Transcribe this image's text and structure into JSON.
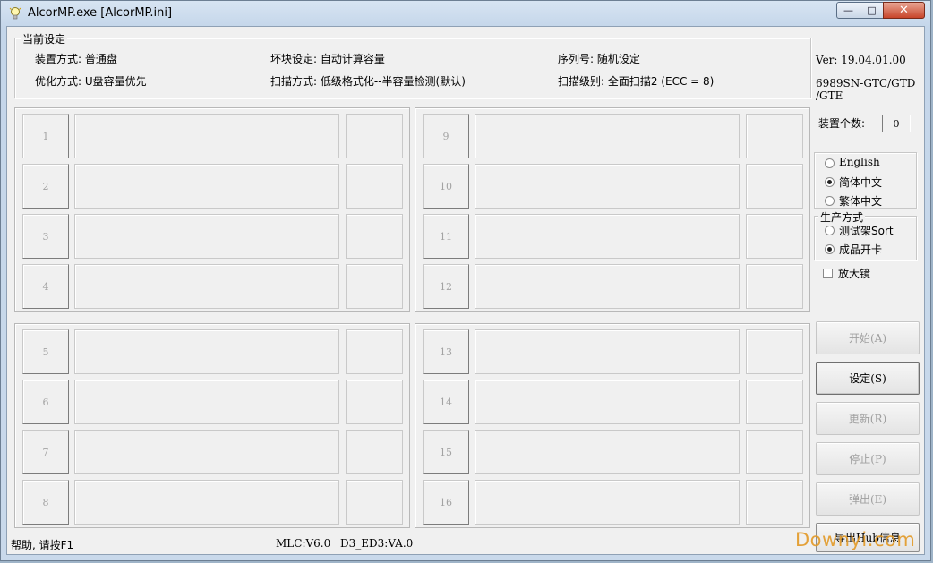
{
  "window": {
    "title": "AlcorMP.exe [AlcorMP.ini]",
    "buttons": {
      "minimize": "—",
      "maximize": "□",
      "close": "✕"
    }
  },
  "current_settings": {
    "legend": "当前设定",
    "device_mode": "装置方式: 普通盘",
    "bad_block": "坏块设定: 自动计算容量",
    "serial": "序列号: 随机设定",
    "optimize": "优化方式: U盘容量优先",
    "scan_mode": "扫描方式: 低级格式化--半容量检测(默认)",
    "scan_level": "扫描级别: 全面扫描2 (ECC = 8)"
  },
  "info": {
    "version": "Ver: 19.04.01.00",
    "model_line1": "6989SN-GTC/GTD",
    "model_line2": "/GTE",
    "device_count_label": "装置个数:",
    "device_count": "0"
  },
  "slots": {
    "group_a": [
      "1",
      "2",
      "3",
      "4"
    ],
    "group_b": [
      "9",
      "10",
      "11",
      "12"
    ],
    "group_c": [
      "5",
      "6",
      "7",
      "8"
    ],
    "group_d": [
      "13",
      "14",
      "15",
      "16"
    ]
  },
  "language": {
    "options": [
      "English",
      "简体中文",
      "繁体中文"
    ],
    "selected": "简体中文"
  },
  "production": {
    "legend": "生产方式",
    "options": [
      "测试架Sort",
      "成品开卡"
    ],
    "selected": "成品开卡"
  },
  "magnifier": {
    "label": "放大镜",
    "checked": false
  },
  "buttons": {
    "start": "开始(A)",
    "settings": "设定(S)",
    "refresh": "更新(R)",
    "stop": "停止(P)",
    "eject": "弹出(E)",
    "export_hub": "导出Hub信息"
  },
  "status": {
    "help": "帮助, 请按F1",
    "mlc": "MLC:V6.0",
    "firmware": "D3_ED3:VA.0"
  },
  "watermark": "Downyi.com",
  "colors": {
    "window_frame": "#c4d6ea",
    "client_bg": "#f0f0f0",
    "disabled_text": "#a0a0a0",
    "watermark": "#e39b2a"
  }
}
